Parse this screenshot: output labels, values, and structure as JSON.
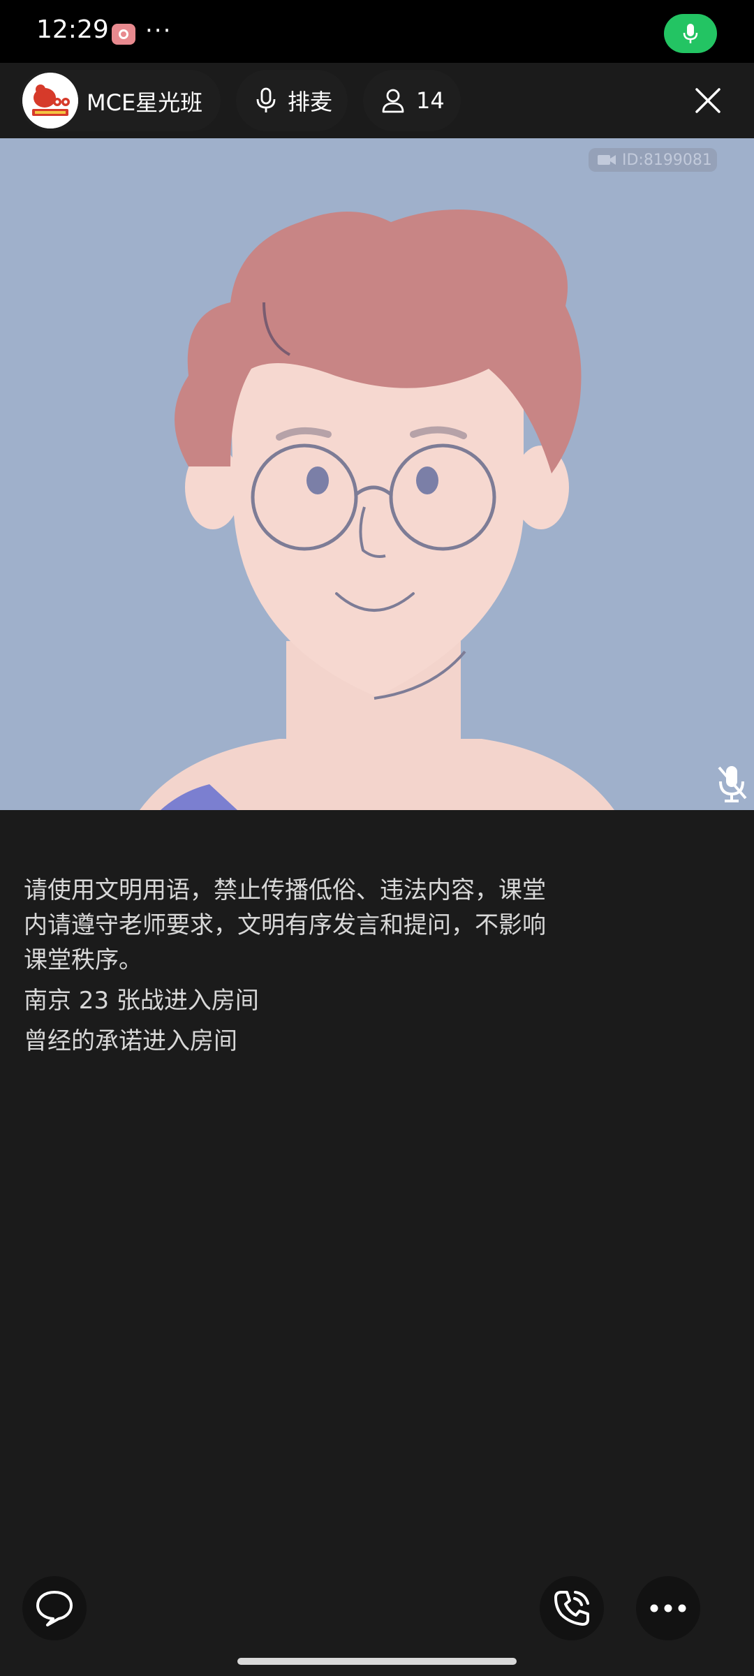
{
  "status_bar": {
    "time": "12:29",
    "dots": "···"
  },
  "header": {
    "channel_name": "MCE星光班",
    "queue_label": "排麦",
    "member_count": "14"
  },
  "video": {
    "id_label": "ID:8199081"
  },
  "chat": {
    "notice": "请使用文明用语，禁止传播低俗、违法内容，课堂内请遵守老师要求，文明有序发言和提问，不影响课堂秩序。",
    "messages": [
      "南京 23 张战进入房间",
      "曾经的承诺进入房间"
    ]
  },
  "icons": {
    "status_mic": "mic-icon",
    "queue": "mic-icon",
    "members": "person-icon",
    "close": "close-icon",
    "video_badge": "video-camera-icon",
    "muted": "mic-off-icon",
    "chat": "chat-bubble-icon",
    "call": "phone-icon",
    "more": "more-icon"
  },
  "colors": {
    "accent_green": "#23c463",
    "background": "#1b1b1b",
    "video_bg": "#9fb0cb"
  }
}
